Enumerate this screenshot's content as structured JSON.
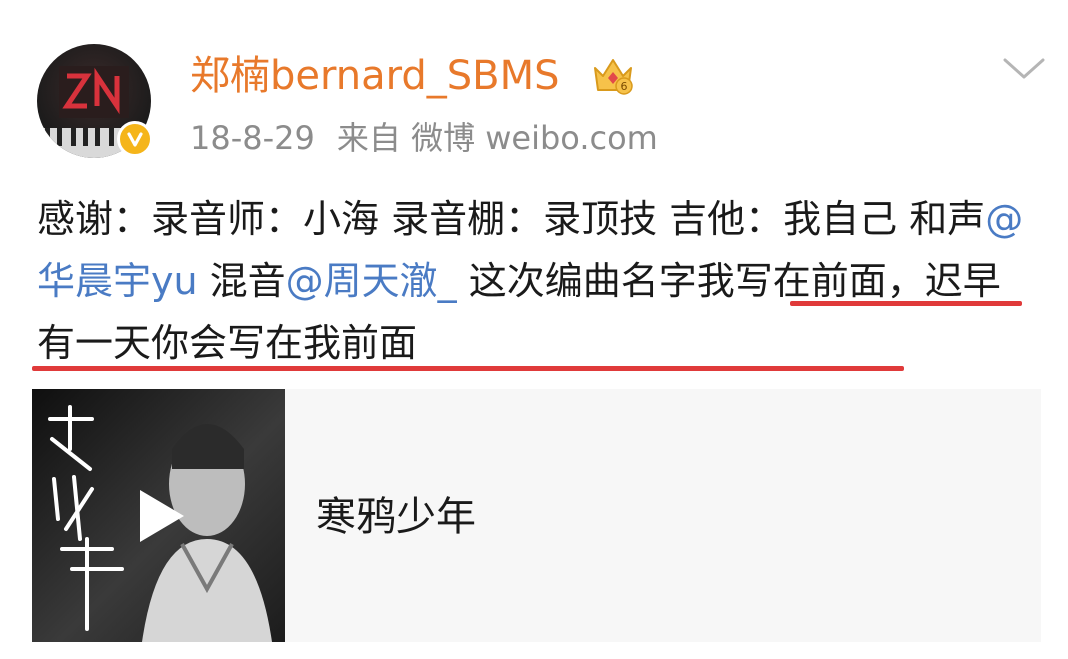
{
  "user": {
    "name": "郑楠bernard_SBMS",
    "avatar_icon": "zn-logo-avatar",
    "verified_icon": "verified-v-badge",
    "badge_icon": "crown-level-badge",
    "badge_level": "6"
  },
  "meta": {
    "date": "18-8-29",
    "source": "来自 微博 weibo.com"
  },
  "post": {
    "t1": "感谢：录音师：小海 录音棚：录顶技 吉他：我自己 和声",
    "m1": "@华晨宇yu",
    "t2": " 混音",
    "m2": "@周天澈_",
    "t3": " 这次编曲名字我写在前面，迟早有一天你会写在我前面"
  },
  "music_card": {
    "title": "寒鸦少年",
    "cover_icon": "album-cover",
    "play_icon": "play-icon"
  },
  "colors": {
    "username": "#e8792b",
    "mention": "#4a7bc4",
    "meta": "#8c8c8c",
    "underline": "#e03a3a"
  }
}
